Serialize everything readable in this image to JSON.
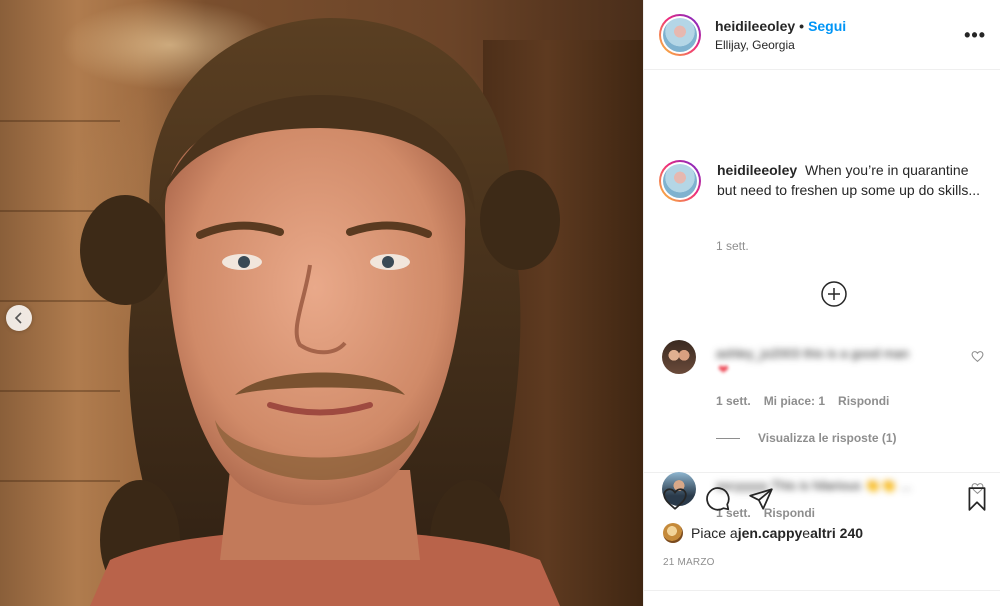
{
  "post": {
    "username": "heidileeoley",
    "follow_label": "Segui",
    "separator": "•",
    "location": "Ellijay, Georgia",
    "more_label": "•••"
  },
  "caption": {
    "username": "heidileeoley",
    "text": "When you’re in quarantine but need to freshen up some up do skills...",
    "time": "1 sett."
  },
  "comments": [
    {
      "blurred_text": "ashley_jo2003 this is a good man",
      "time": "1 sett.",
      "likes": "Mi piace: 1",
      "reply": "Rispondi"
    },
    {
      "blurred_text": "sscyyyyy This is hilarious 👏👏 ...",
      "time": "1 sett.",
      "reply": "Rispondi"
    }
  ],
  "view_replies": "Visualizza le risposte (1)",
  "likes": {
    "prefix": "Piace a ",
    "user": "jen.cappy",
    "middle": " e ",
    "others": "altri 240"
  },
  "date": "21 MARZO",
  "icons": [
    "chevron-left-icon",
    "more-icon",
    "plus-circle-icon",
    "heart-icon",
    "comment-icon",
    "share-icon",
    "bookmark-icon"
  ],
  "colors": {
    "accent": "#0095f6",
    "secondary_text": "#8e8e8e",
    "border": "#efefef",
    "heart": "#ed4956"
  }
}
